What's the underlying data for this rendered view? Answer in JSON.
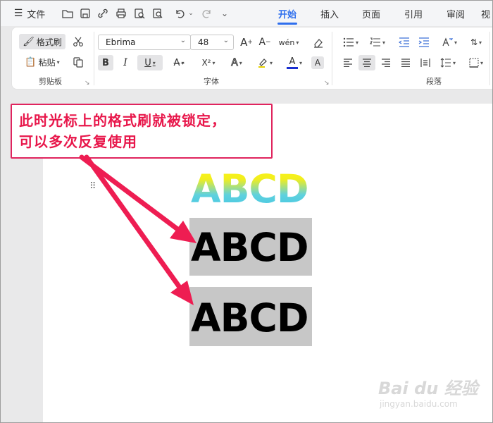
{
  "menubar": {
    "hamburger_label": "文件",
    "tabs": [
      "开始",
      "插入",
      "页面",
      "引用",
      "审阅",
      "视"
    ],
    "active_tab": "开始"
  },
  "ribbon": {
    "clipboard": {
      "format_painter_label": "格式刷",
      "paste_label": "粘贴",
      "group_label": "剪贴板"
    },
    "font": {
      "font_name": "Ebrima",
      "font_size": "48",
      "group_label": "字体",
      "bold_label": "B",
      "italic_label": "I",
      "underline_label": "U",
      "strike_label": "A",
      "superscript_label": "X²",
      "font_color_label": "A",
      "shading_label": "A",
      "grow_label": "A",
      "shrink_label": "A",
      "pinyin_label": "wén",
      "font_color_bar": "#1a2fd0"
    },
    "paragraph": {
      "group_label": "段落"
    }
  },
  "document": {
    "gradient_text": "ABCD",
    "copy1_text": "ABCD",
    "copy2_text": "ABCD",
    "selection_color": "#c7c7c7"
  },
  "callout": {
    "line1": "此时光标上的格式刷就被锁定，",
    "line2": "可以多次反复使用",
    "color": "#e8174b"
  },
  "watermark": {
    "main": "Bai du 经验",
    "sub": "jingyan.baidu.com"
  }
}
